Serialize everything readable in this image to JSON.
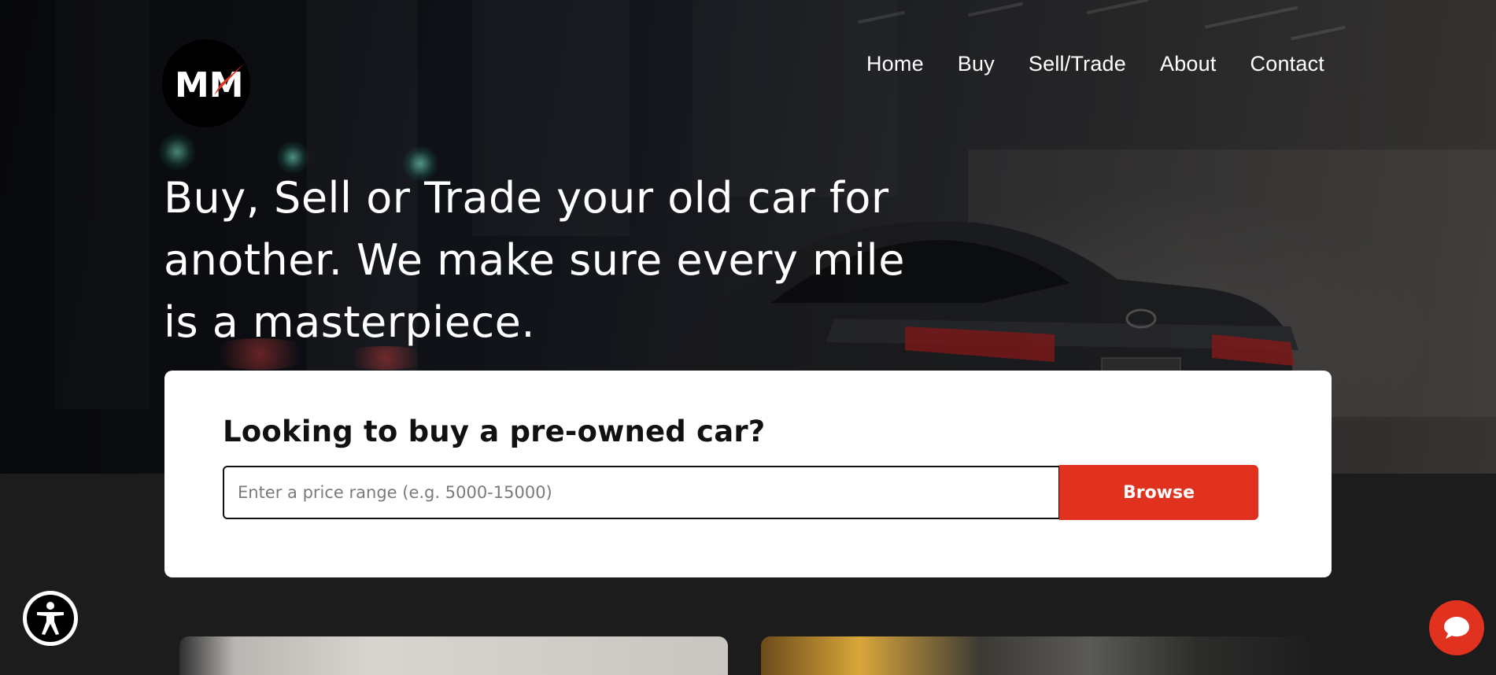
{
  "brand": {
    "logo_text": "MM",
    "logo_icon": "speedometer-needle-icon",
    "accent_color": "#e0321e"
  },
  "nav": {
    "items": [
      {
        "label": "Home"
      },
      {
        "label": "Buy"
      },
      {
        "label": "Sell/Trade"
      },
      {
        "label": "About"
      },
      {
        "label": "Contact"
      }
    ]
  },
  "hero": {
    "headline": "Buy, Sell or Trade your old car for another. We make sure every mile is a masterpiece."
  },
  "search": {
    "heading": "Looking to buy a pre-owned car?",
    "placeholder": "Enter a price range (e.g. 5000-15000)",
    "value": "",
    "button_label": "Browse"
  },
  "widgets": {
    "accessibility_icon": "accessibility-person-icon",
    "chat_icon": "chat-bubble-icon"
  }
}
